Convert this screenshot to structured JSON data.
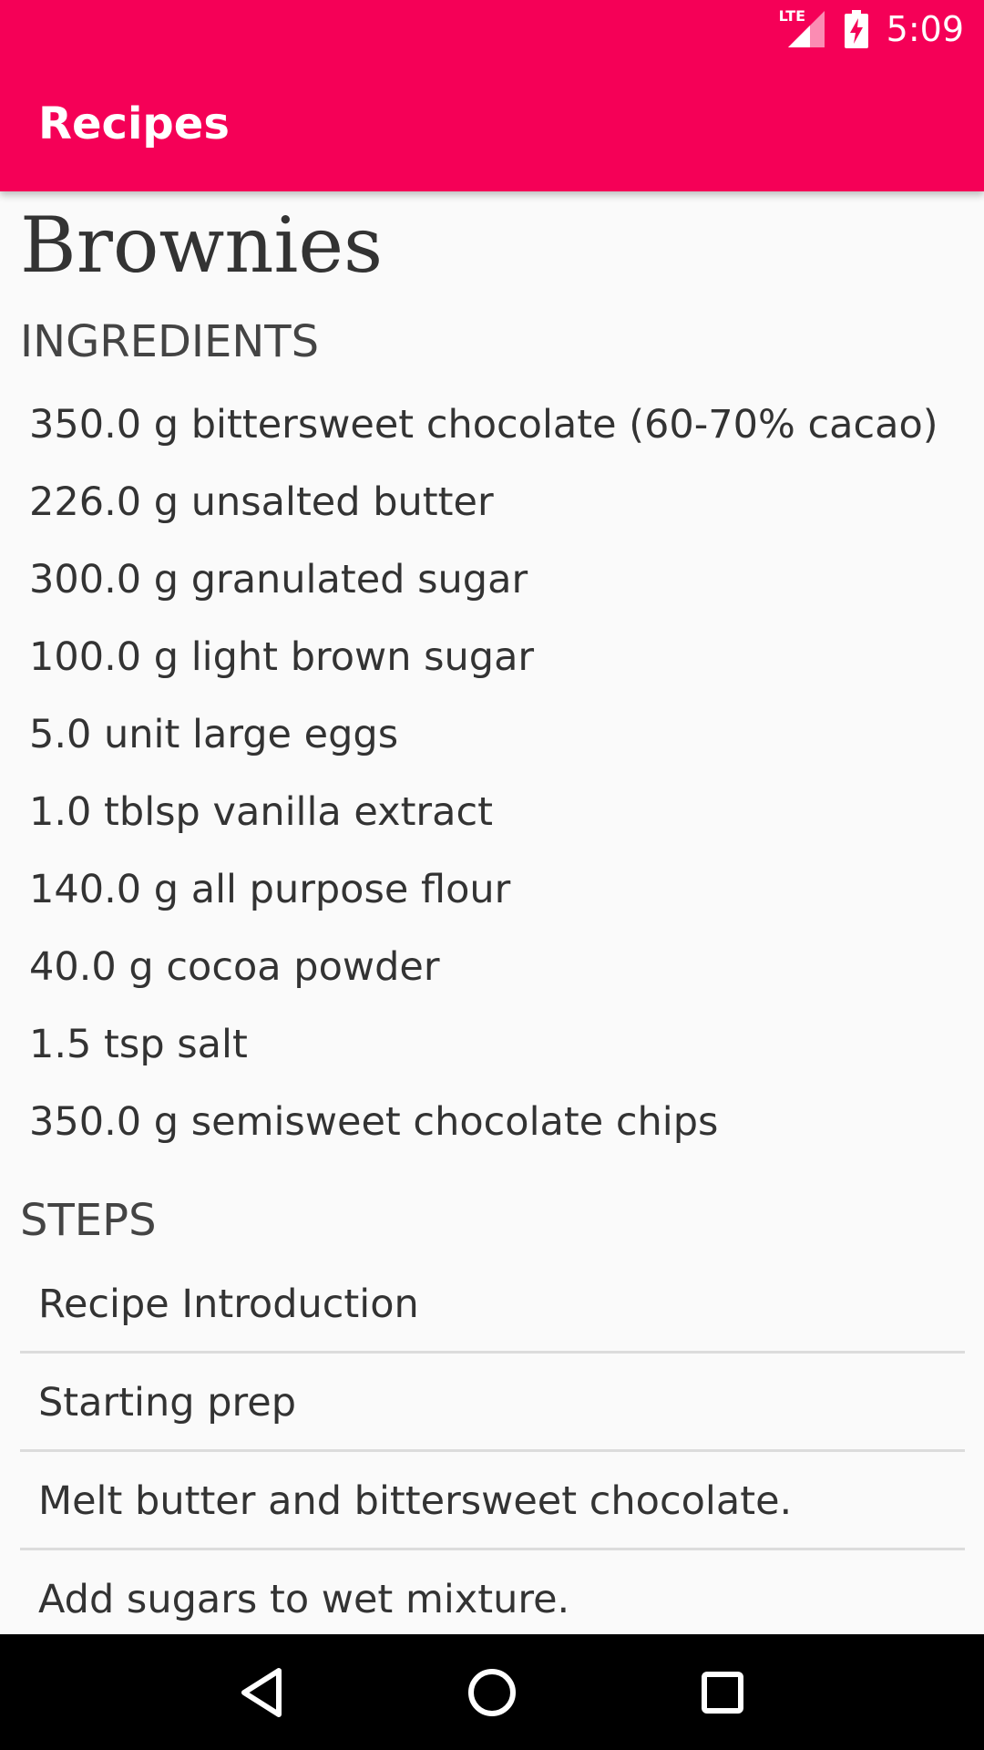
{
  "status_bar": {
    "time": "5:09",
    "network_label": "LTE",
    "icons": [
      "lte-signal-icon",
      "battery-charging-icon"
    ]
  },
  "app_bar": {
    "title": "Recipes",
    "color": "#f50057"
  },
  "recipe": {
    "name": "Brownies",
    "ingredients_heading": "INGREDIENTS",
    "ingredients": [
      "350.0 g bittersweet chocolate (60-70% cacao)",
      "226.0 g unsalted butter",
      "300.0 g granulated sugar",
      "100.0 g light brown sugar",
      "5.0 unit large eggs",
      "1.0 tblsp vanilla extract",
      "140.0 g all purpose flour",
      "40.0 g cocoa powder",
      "1.5 tsp salt",
      "350.0 g semisweet chocolate chips"
    ],
    "steps_heading": "STEPS",
    "steps": [
      "Recipe Introduction",
      "Starting prep",
      "Melt butter and bittersweet chocolate.",
      "Add sugars to wet mixture."
    ]
  },
  "nav_bar": {
    "buttons": [
      "back-icon",
      "home-icon",
      "recents-icon"
    ]
  }
}
